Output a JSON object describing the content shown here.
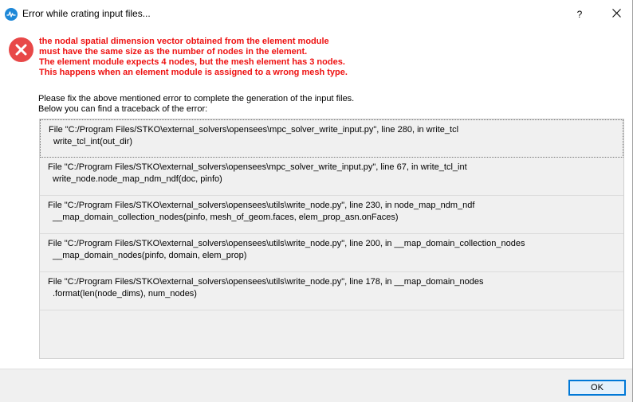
{
  "window": {
    "title": "Error while crating input files...",
    "help_label": "?",
    "close_label": "✕"
  },
  "error": {
    "lines": [
      "the nodal spatial dimension vector obtained from the element module",
      "must have the same size as the number of nodes in the element.",
      "The element module expects 4 nodes, but the mesh element has 3 nodes.",
      "This happens when an element module is assigned to a wrong mesh type."
    ],
    "color": "#ee1111"
  },
  "instructions": {
    "line1": "Please fix the above mentioned error to complete the generation of the input files.",
    "line2": "Below you can find a traceback of the error:"
  },
  "traceback": [
    {
      "file": "File \"C:/Program Files/STKO\\external_solvers\\opensees\\mpc_solver_write_input.py\", line 280, in write_tcl",
      "code": "write_tcl_int(out_dir)"
    },
    {
      "file": "File \"C:/Program Files/STKO\\external_solvers\\opensees\\mpc_solver_write_input.py\", line 67, in write_tcl_int",
      "code": "write_node.node_map_ndm_ndf(doc, pinfo)"
    },
    {
      "file": "File \"C:/Program Files/STKO\\external_solvers\\opensees\\utils\\write_node.py\", line 230, in node_map_ndm_ndf",
      "code": "__map_domain_collection_nodes(pinfo, mesh_of_geom.faces, elem_prop_asn.onFaces)"
    },
    {
      "file": "File \"C:/Program Files/STKO\\external_solvers\\opensees\\utils\\write_node.py\", line 200, in __map_domain_collection_nodes",
      "code": "__map_domain_nodes(pinfo, domain, elem_prop)"
    },
    {
      "file": "File \"C:/Program Files/STKO\\external_solvers\\opensees\\utils\\write_node.py\", line 178, in __map_domain_nodes",
      "code": ".format(len(node_dims), num_nodes)"
    }
  ],
  "footer": {
    "ok_label": "OK",
    "accent": "#0078d7"
  }
}
